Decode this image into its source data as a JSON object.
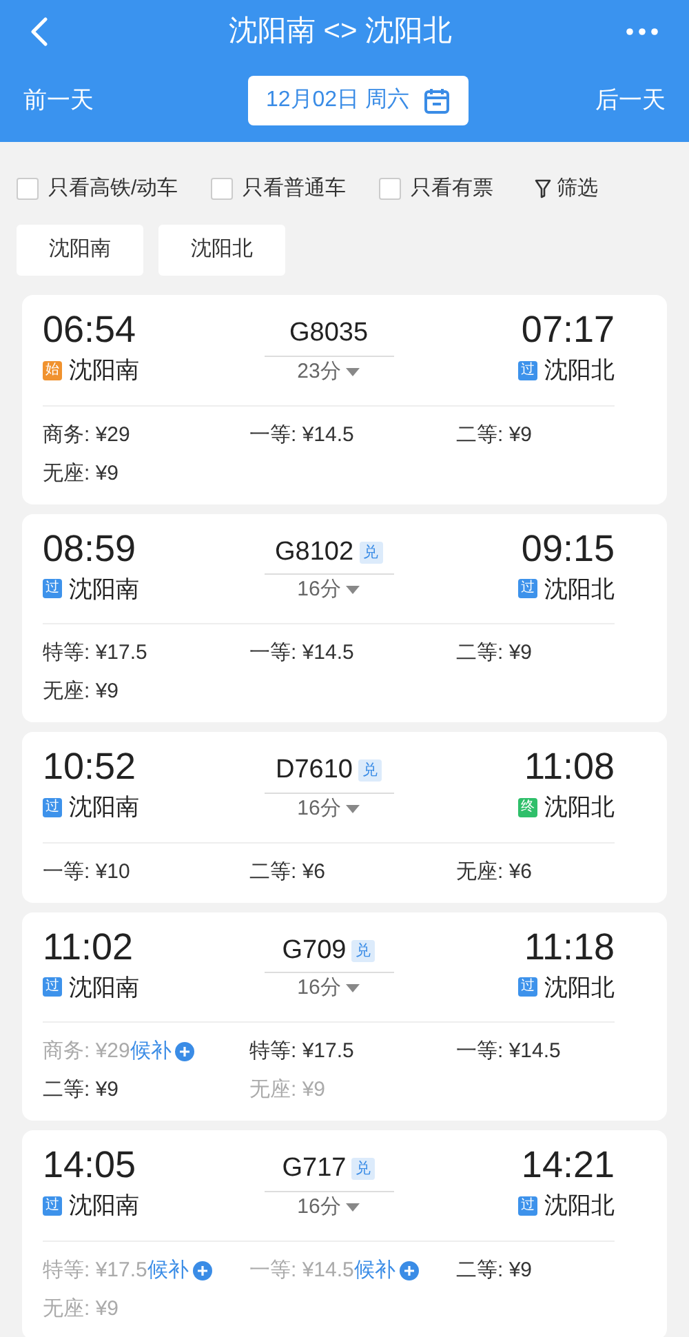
{
  "header": {
    "title": "沈阳南 <> 沈阳北",
    "prev_day": "前一天",
    "date": "12月02日 周六",
    "next_day": "后一天"
  },
  "filters": [
    {
      "label": "只看高铁/动车",
      "checked": false
    },
    {
      "label": "只看普通车",
      "checked": false
    },
    {
      "label": "只看有票",
      "checked": false
    }
  ],
  "filter_button": "筛选",
  "stations": [
    {
      "label": "沈阳南",
      "selected": false
    },
    {
      "label": "沈阳北",
      "selected": false
    }
  ],
  "trains": [
    {
      "depart": "06:54",
      "from": {
        "badge": "始",
        "kind": "start",
        "name": "沈阳南"
      },
      "number": "G8035",
      "duration": "23分",
      "arrive": "07:17",
      "to": {
        "badge": "过",
        "kind": "pass",
        "name": "沈阳北"
      },
      "seats": [
        {
          "text": "商务: ¥29",
          "sold_out": false
        },
        {
          "text": "一等: ¥14.5",
          "sold_out": false
        },
        {
          "text": "二等: ¥9",
          "sold_out": false
        },
        {
          "text": "无座: ¥9",
          "sold_out": false
        }
      ]
    },
    {
      "depart": "08:59",
      "from": {
        "badge": "过",
        "kind": "pass",
        "name": "沈阳南"
      },
      "number": "G8102",
      "tag": "兑",
      "duration": "16分",
      "arrive": "09:15",
      "to": {
        "badge": "过",
        "kind": "pass",
        "name": "沈阳北"
      },
      "seats": [
        {
          "text": "特等: ¥17.5",
          "sold_out": false
        },
        {
          "text": "一等: ¥14.5",
          "sold_out": false
        },
        {
          "text": "二等: ¥9",
          "sold_out": false
        },
        {
          "text": "无座: ¥9",
          "sold_out": false
        }
      ]
    },
    {
      "depart": "10:52",
      "from": {
        "badge": "过",
        "kind": "pass",
        "name": "沈阳南"
      },
      "number": "D7610",
      "tag": "兑",
      "duration": "16分",
      "arrive": "11:08",
      "to": {
        "badge": "终",
        "kind": "end",
        "name": "沈阳北"
      },
      "seats": [
        {
          "text": "一等: ¥10",
          "sold_out": false
        },
        {
          "text": "二等: ¥6",
          "sold_out": false
        },
        {
          "text": "无座: ¥6",
          "sold_out": false
        }
      ]
    },
    {
      "depart": "11:02",
      "from": {
        "badge": "过",
        "kind": "pass",
        "name": "沈阳南"
      },
      "number": "G709",
      "tag": "兑",
      "duration": "16分",
      "arrive": "11:18",
      "to": {
        "badge": "过",
        "kind": "pass",
        "name": "沈阳北"
      },
      "seats": [
        {
          "text": "商务: ¥29",
          "sold_out": true,
          "waitlist": "候补"
        },
        {
          "text": "特等: ¥17.5",
          "sold_out": false
        },
        {
          "text": "一等: ¥14.5",
          "sold_out": false
        },
        {
          "text": "二等: ¥9",
          "sold_out": false
        },
        {
          "text": "无座: ¥9",
          "sold_out": true
        }
      ]
    },
    {
      "depart": "14:05",
      "from": {
        "badge": "过",
        "kind": "pass",
        "name": "沈阳南"
      },
      "number": "G717",
      "tag": "兑",
      "duration": "16分",
      "arrive": "14:21",
      "to": {
        "badge": "过",
        "kind": "pass",
        "name": "沈阳北"
      },
      "seats": [
        {
          "text": "特等: ¥17.5",
          "sold_out": true,
          "waitlist": "候补"
        },
        {
          "text": "一等: ¥14.5",
          "sold_out": true,
          "waitlist": "候补"
        },
        {
          "text": "二等: ¥9",
          "sold_out": false
        },
        {
          "text": "无座: ¥9",
          "sold_out": true
        }
      ]
    }
  ]
}
